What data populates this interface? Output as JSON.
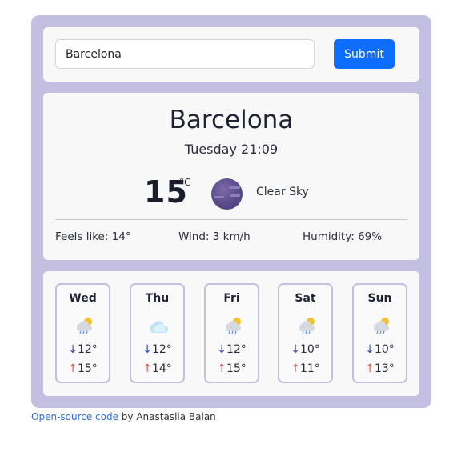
{
  "search": {
    "value": "Barcelona",
    "submit_label": "Submit"
  },
  "current": {
    "city": "Barcelona",
    "datetime": "Tuesday 21:09",
    "temperature": "15",
    "unit": "°C",
    "description": "Clear Sky",
    "icon": "night-clear-moon-icon",
    "feels_like": "Feels like: 14°",
    "wind": "Wind: 3 km/h",
    "humidity": "Humidity: 69%"
  },
  "forecast": [
    {
      "day": "Wed",
      "icon": "rain-sun-icon",
      "min": "12°",
      "max": "15°"
    },
    {
      "day": "Thu",
      "icon": "cloud-icon",
      "min": "12°",
      "max": "14°"
    },
    {
      "day": "Fri",
      "icon": "rain-sun-icon",
      "min": "12°",
      "max": "15°"
    },
    {
      "day": "Sat",
      "icon": "rain-sun-icon",
      "min": "10°",
      "max": "11°"
    },
    {
      "day": "Sun",
      "icon": "rain-sun-icon",
      "min": "10°",
      "max": "13°"
    }
  ],
  "arrows": {
    "down": "↓",
    "up": "↑"
  },
  "footer": {
    "link_text": "Open-source code",
    "suffix": " by Anastasiia Balan"
  },
  "colors": {
    "app_bg": "#c2bfe0",
    "card_bg": "#f8f8f9",
    "accent": "#0d6efd",
    "min_arrow": "#3c4aa8",
    "max_arrow": "#e0564a",
    "link": "#2f6fd6"
  }
}
